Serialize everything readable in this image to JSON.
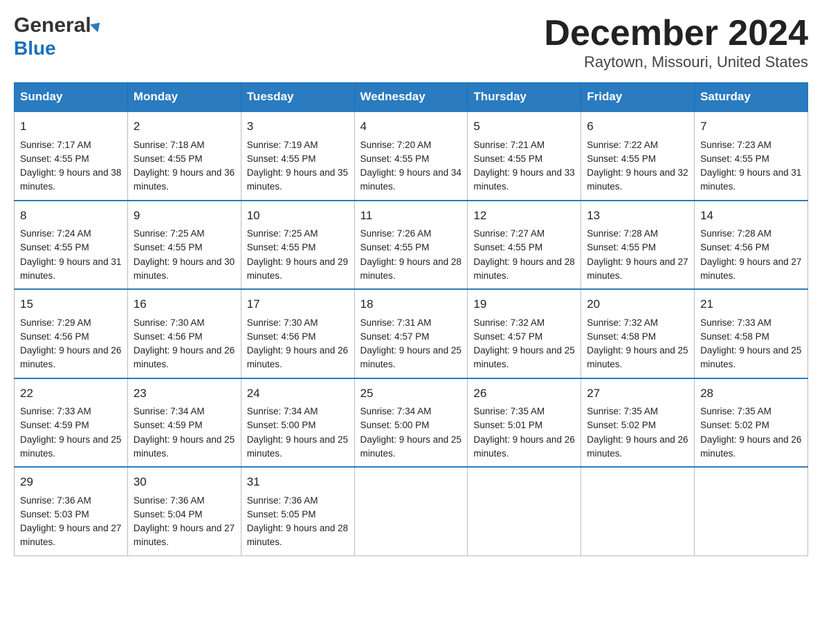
{
  "header": {
    "logo_general": "General",
    "logo_blue": "Blue",
    "month_title": "December 2024",
    "location": "Raytown, Missouri, United States"
  },
  "days": [
    "Sunday",
    "Monday",
    "Tuesday",
    "Wednesday",
    "Thursday",
    "Friday",
    "Saturday"
  ],
  "weeks": [
    [
      {
        "num": "1",
        "sunrise": "7:17 AM",
        "sunset": "4:55 PM",
        "daylight": "9 hours and 38 minutes."
      },
      {
        "num": "2",
        "sunrise": "7:18 AM",
        "sunset": "4:55 PM",
        "daylight": "9 hours and 36 minutes."
      },
      {
        "num": "3",
        "sunrise": "7:19 AM",
        "sunset": "4:55 PM",
        "daylight": "9 hours and 35 minutes."
      },
      {
        "num": "4",
        "sunrise": "7:20 AM",
        "sunset": "4:55 PM",
        "daylight": "9 hours and 34 minutes."
      },
      {
        "num": "5",
        "sunrise": "7:21 AM",
        "sunset": "4:55 PM",
        "daylight": "9 hours and 33 minutes."
      },
      {
        "num": "6",
        "sunrise": "7:22 AM",
        "sunset": "4:55 PM",
        "daylight": "9 hours and 32 minutes."
      },
      {
        "num": "7",
        "sunrise": "7:23 AM",
        "sunset": "4:55 PM",
        "daylight": "9 hours and 31 minutes."
      }
    ],
    [
      {
        "num": "8",
        "sunrise": "7:24 AM",
        "sunset": "4:55 PM",
        "daylight": "9 hours and 31 minutes."
      },
      {
        "num": "9",
        "sunrise": "7:25 AM",
        "sunset": "4:55 PM",
        "daylight": "9 hours and 30 minutes."
      },
      {
        "num": "10",
        "sunrise": "7:25 AM",
        "sunset": "4:55 PM",
        "daylight": "9 hours and 29 minutes."
      },
      {
        "num": "11",
        "sunrise": "7:26 AM",
        "sunset": "4:55 PM",
        "daylight": "9 hours and 28 minutes."
      },
      {
        "num": "12",
        "sunrise": "7:27 AM",
        "sunset": "4:55 PM",
        "daylight": "9 hours and 28 minutes."
      },
      {
        "num": "13",
        "sunrise": "7:28 AM",
        "sunset": "4:55 PM",
        "daylight": "9 hours and 27 minutes."
      },
      {
        "num": "14",
        "sunrise": "7:28 AM",
        "sunset": "4:56 PM",
        "daylight": "9 hours and 27 minutes."
      }
    ],
    [
      {
        "num": "15",
        "sunrise": "7:29 AM",
        "sunset": "4:56 PM",
        "daylight": "9 hours and 26 minutes."
      },
      {
        "num": "16",
        "sunrise": "7:30 AM",
        "sunset": "4:56 PM",
        "daylight": "9 hours and 26 minutes."
      },
      {
        "num": "17",
        "sunrise": "7:30 AM",
        "sunset": "4:56 PM",
        "daylight": "9 hours and 26 minutes."
      },
      {
        "num": "18",
        "sunrise": "7:31 AM",
        "sunset": "4:57 PM",
        "daylight": "9 hours and 25 minutes."
      },
      {
        "num": "19",
        "sunrise": "7:32 AM",
        "sunset": "4:57 PM",
        "daylight": "9 hours and 25 minutes."
      },
      {
        "num": "20",
        "sunrise": "7:32 AM",
        "sunset": "4:58 PM",
        "daylight": "9 hours and 25 minutes."
      },
      {
        "num": "21",
        "sunrise": "7:33 AM",
        "sunset": "4:58 PM",
        "daylight": "9 hours and 25 minutes."
      }
    ],
    [
      {
        "num": "22",
        "sunrise": "7:33 AM",
        "sunset": "4:59 PM",
        "daylight": "9 hours and 25 minutes."
      },
      {
        "num": "23",
        "sunrise": "7:34 AM",
        "sunset": "4:59 PM",
        "daylight": "9 hours and 25 minutes."
      },
      {
        "num": "24",
        "sunrise": "7:34 AM",
        "sunset": "5:00 PM",
        "daylight": "9 hours and 25 minutes."
      },
      {
        "num": "25",
        "sunrise": "7:34 AM",
        "sunset": "5:00 PM",
        "daylight": "9 hours and 25 minutes."
      },
      {
        "num": "26",
        "sunrise": "7:35 AM",
        "sunset": "5:01 PM",
        "daylight": "9 hours and 26 minutes."
      },
      {
        "num": "27",
        "sunrise": "7:35 AM",
        "sunset": "5:02 PM",
        "daylight": "9 hours and 26 minutes."
      },
      {
        "num": "28",
        "sunrise": "7:35 AM",
        "sunset": "5:02 PM",
        "daylight": "9 hours and 26 minutes."
      }
    ],
    [
      {
        "num": "29",
        "sunrise": "7:36 AM",
        "sunset": "5:03 PM",
        "daylight": "9 hours and 27 minutes."
      },
      {
        "num": "30",
        "sunrise": "7:36 AM",
        "sunset": "5:04 PM",
        "daylight": "9 hours and 27 minutes."
      },
      {
        "num": "31",
        "sunrise": "7:36 AM",
        "sunset": "5:05 PM",
        "daylight": "9 hours and 28 minutes."
      },
      null,
      null,
      null,
      null
    ]
  ],
  "labels": {
    "sunrise": "Sunrise:",
    "sunset": "Sunset:",
    "daylight": "Daylight:"
  }
}
